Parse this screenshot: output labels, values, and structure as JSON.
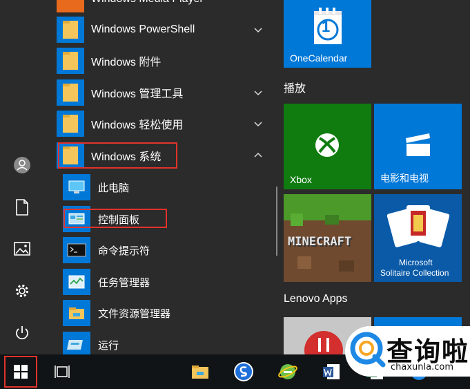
{
  "colors": {
    "accent": "#0078d7",
    "background": "#2b2b2b",
    "taskbar": "#101417",
    "highlight_border": "#e3322b",
    "xbox_tile": "#107c10",
    "folder": "#f3c55a"
  },
  "app_list": {
    "top_partial": "Windows Media Player",
    "items": [
      {
        "label": "Windows PowerShell",
        "icon": "folder-icon",
        "expand": "chevron-down-icon"
      },
      {
        "label": "Windows 附件",
        "icon": "folder-icon",
        "expand": "chevron-down-icon"
      },
      {
        "label": "Windows 管理工具",
        "icon": "folder-icon",
        "expand": "chevron-down-icon"
      },
      {
        "label": "Windows 轻松使用",
        "icon": "folder-icon",
        "expand": "chevron-down-icon"
      },
      {
        "label": "Windows 系统",
        "icon": "folder-icon",
        "expand": "chevron-up-icon"
      }
    ],
    "subitems": [
      {
        "label": "此电脑",
        "icon": "computer-icon"
      },
      {
        "label": "控制面板",
        "icon": "control-panel-icon"
      },
      {
        "label": "命令提示符",
        "icon": "command-prompt-icon"
      },
      {
        "label": "任务管理器",
        "icon": "task-manager-icon"
      },
      {
        "label": "文件资源管理器",
        "icon": "file-explorer-icon"
      },
      {
        "label": "运行",
        "icon": "run-icon"
      }
    ]
  },
  "rail": [
    "user-icon",
    "documents-icon",
    "pictures-icon",
    "settings-icon",
    "power-icon"
  ],
  "tiles": {
    "top": {
      "label": "OneCalendar",
      "icon": "calendar-icon",
      "digit": "1"
    },
    "group_play": "播放",
    "xbox": "Xbox",
    "movies": "电影和电视",
    "minecraft": "MINECRAFT",
    "solitaire_line1": "Microsoft",
    "solitaire_line2": "Solitaire Collection",
    "group_lenovo": "Lenovo Apps"
  },
  "taskbar": [
    "start-icon",
    "task-view-icon",
    "file-explorer-icon",
    "sogou-icon",
    "ie-icon",
    "word-icon",
    "excel-icon",
    "network-icon"
  ],
  "watermark": {
    "text": "查询啦",
    "url": "chaxunla.com"
  }
}
